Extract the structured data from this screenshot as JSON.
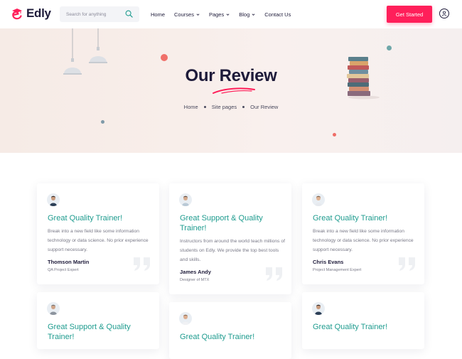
{
  "brand": {
    "name": "Edly",
    "color": "#ff1f5a"
  },
  "header": {
    "search_placeholder": "Search for anything",
    "nav": [
      {
        "label": "Home",
        "has_dropdown": false
      },
      {
        "label": "Courses",
        "has_dropdown": true
      },
      {
        "label": "Pages",
        "has_dropdown": true
      },
      {
        "label": "Blog",
        "has_dropdown": true
      },
      {
        "label": "Contact Us",
        "has_dropdown": false
      }
    ],
    "cta_label": "Get Started",
    "user_icon": "user-icon"
  },
  "hero": {
    "title": "Our Review",
    "breadcrumb": [
      "Home",
      "Site pages",
      "Our Review"
    ]
  },
  "colors": {
    "accent_teal": "#1f9c8f",
    "dark": "#1e1b3a"
  },
  "reviews": [
    {
      "title": "Great Quality Trainer!",
      "text": "Break into a new field like some information technology or data science. No prior experience support necessary.",
      "name": "Thomson Martin",
      "role": "QA Project Expert"
    },
    {
      "title": "Great Support & Quality Trainer!",
      "text": "Instructors from around the world teach millions of students on Edly. We provide the top best tools and skills.",
      "name": "James Andy",
      "role": "Designer of MTX"
    },
    {
      "title": "Great Quality Trainer!",
      "text": "Break into a new field like some information technology or data science. No prior experience support necessary.",
      "name": "Chris Evans",
      "role": "Project Management Expert"
    },
    {
      "title": "Great Support & Quality Trainer!"
    },
    {
      "title": "Great Quality Trainer!"
    },
    {
      "title": "Great Quality Trainer!"
    }
  ]
}
